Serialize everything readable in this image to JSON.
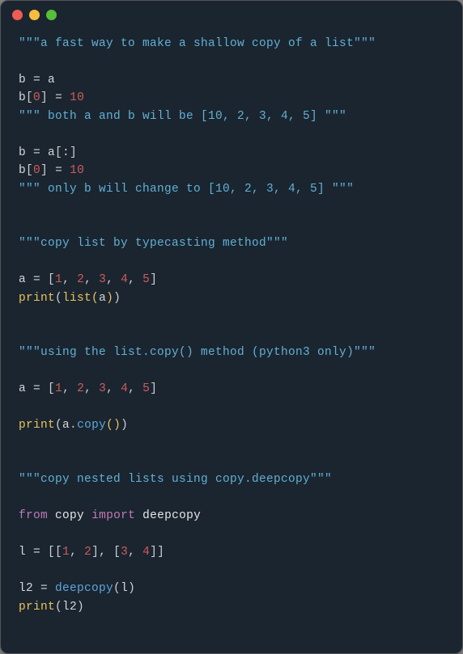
{
  "title_bar": {
    "dot_colors": {
      "close": "#ee5c54",
      "min": "#f5bd40",
      "max": "#56c038"
    }
  },
  "code": {
    "c1": "\"\"\"a fast way to make a shallow copy of a list\"\"\"",
    "l_b_eq_a_b": "b",
    "l_b_eq_a_eq": " = ",
    "l_b_eq_a_a": "a",
    "l_bidx_b": "b",
    "l_bidx_open": "[",
    "l_bidx_0": "0",
    "l_bidx_close": "]",
    "l_bidx_eq": " = ",
    "l_bidx_10": "10",
    "c2": "\"\"\" both a and b will be [10, 2, 3, 4, 5] \"\"\"",
    "l_slice_b": "b",
    "l_slice_eq": " = ",
    "l_slice_a": "a",
    "l_slice_br": "[:]",
    "c3": "\"\"\" only b will change to [10, 2, 3, 4, 5] \"\"\"",
    "c4": "\"\"\"copy list by typecasting method\"\"\"",
    "l_aeq_a": "a",
    "l_aeq_eq": " = ",
    "l_aeq_open": "[",
    "l_aeq_1": "1",
    "l_aeq_c1": ", ",
    "l_aeq_2": "2",
    "l_aeq_c2": ", ",
    "l_aeq_3": "3",
    "l_aeq_c3": ", ",
    "l_aeq_4": "4",
    "l_aeq_c4": ", ",
    "l_aeq_5": "5",
    "l_aeq_close": "]",
    "l_print": "print",
    "l_list": "list",
    "l_po": "(",
    "l_pc": ")",
    "l_a_arg": "a",
    "c5": "\"\"\"using the list.copy() method (python3 only)\"\"\"",
    "l_copy": "copy",
    "l_dot": ".",
    "c6": "\"\"\"copy nested lists using copy.deepcopy\"\"\"",
    "kw_from": "from",
    "mod_copy": "copy",
    "kw_import": "import",
    "fn_deep": "deepcopy",
    "var_l": "l",
    "var_l2": "l2",
    "nested_open": "[[",
    "nested_mid": "], [",
    "nested_close": "]]"
  }
}
